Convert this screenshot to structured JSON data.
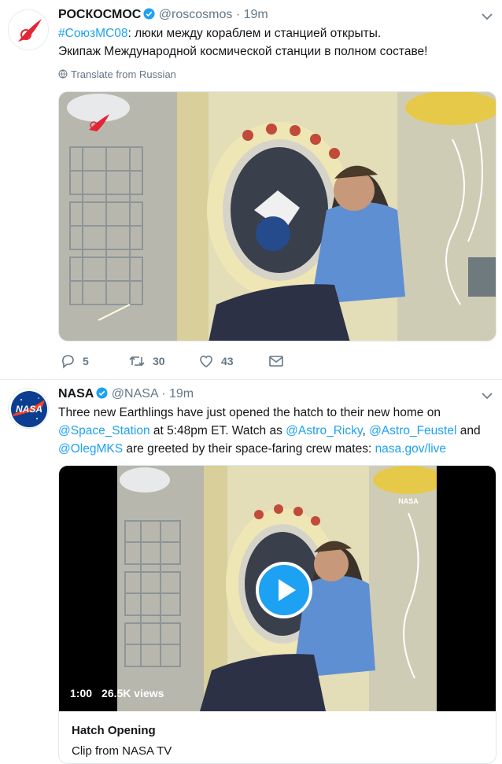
{
  "tweets": [
    {
      "name": "РОСКОСМОС",
      "handle": "@roscosmos",
      "separator": "·",
      "time": "19m",
      "hashtag": "#СоюзМС08",
      "text_line1": ": люки между кораблем и станцией открыты.",
      "text_line2": "Экипаж Международной космической станции в полном составе!",
      "translate_label": "Translate from Russian",
      "counts": {
        "replies": "5",
        "retweets": "30",
        "likes": "43"
      }
    },
    {
      "name": "NASA",
      "handle": "@NASA",
      "separator": "·",
      "time": "19m",
      "avatar_text": "NASA",
      "text": {
        "p1": "Three new Earthlings have just opened the hatch to their new home on",
        "m1": "@Space_Station",
        "p2": " at 5:48pm ET. Watch as ",
        "m2": "@Astro_Ricky",
        "p3": ", ",
        "m3": "@Astro_Feustel",
        "p4": " and",
        "m4": "@OlegMKS",
        "p5": " are greeted by their space-faring crew mates: ",
        "link": "nasa.gov/live"
      },
      "video": {
        "duration": "1:00",
        "views": "26.5K views",
        "watermark": "NASA"
      },
      "card": {
        "title": "Hatch Opening",
        "subtitle": "Clip from NASA TV"
      }
    }
  ],
  "icons": [
    "verified-badge-icon",
    "chevron-down-icon",
    "globe-icon",
    "reply-icon",
    "retweet-icon",
    "like-icon",
    "direct-message-icon",
    "play-icon",
    "roscosmos-logo",
    "nasa-meatball-logo"
  ],
  "colors": {
    "accent": "#1da1f2",
    "secondary_text": "#657786",
    "verified": "#1da1f2",
    "roscosmos_red": "#e32636",
    "nasa_blue": "#0b3d91"
  }
}
